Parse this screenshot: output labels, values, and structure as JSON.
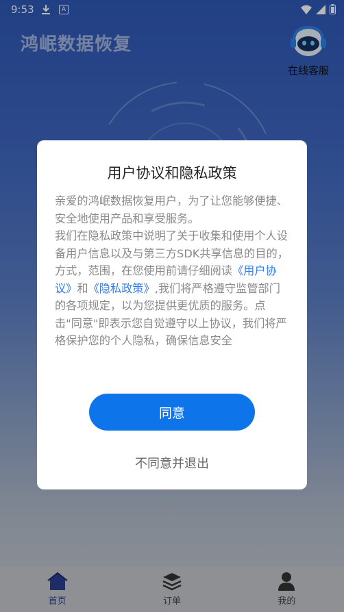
{
  "status_bar": {
    "time": "9:53",
    "notif_icon_text": "A"
  },
  "header": {
    "app_title": "鸿岷数据恢复",
    "service_label": "在线客服"
  },
  "dialog": {
    "title": "用户协议和隐私政策",
    "para1": "亲爱的鸿岷数据恢复用户，为了让您能够便捷、安全地使用产品和享受服务。",
    "para2_a": "我们在隐私政策中说明了关于收集和使用个人设备用户信息以及与第三方SDK共享信息的目的，方式，范围，在您使用前请仔细阅读",
    "link_user_agreement": "《用户协议》",
    "para2_and": "和",
    "link_privacy_policy": "《隐私政策》",
    "para2_b": ",我们将严格遵守监管部门的各项规定，以为您提供更优质的服务。点击\"同意\"即表示您自觉遵守以上协议，我们将严格保护您的个人隐私，确保信息安全",
    "agree_button": "同意",
    "disagree_button": "不同意并退出"
  },
  "bottom_nav": {
    "items": [
      {
        "label": "首页",
        "icon": "home-icon"
      },
      {
        "label": "订单",
        "icon": "layers-icon"
      },
      {
        "label": "我的",
        "icon": "person-icon"
      }
    ]
  },
  "colors": {
    "accent": "#0d74ea",
    "link": "#2f7df0",
    "nav_active": "#2a3f8f"
  }
}
